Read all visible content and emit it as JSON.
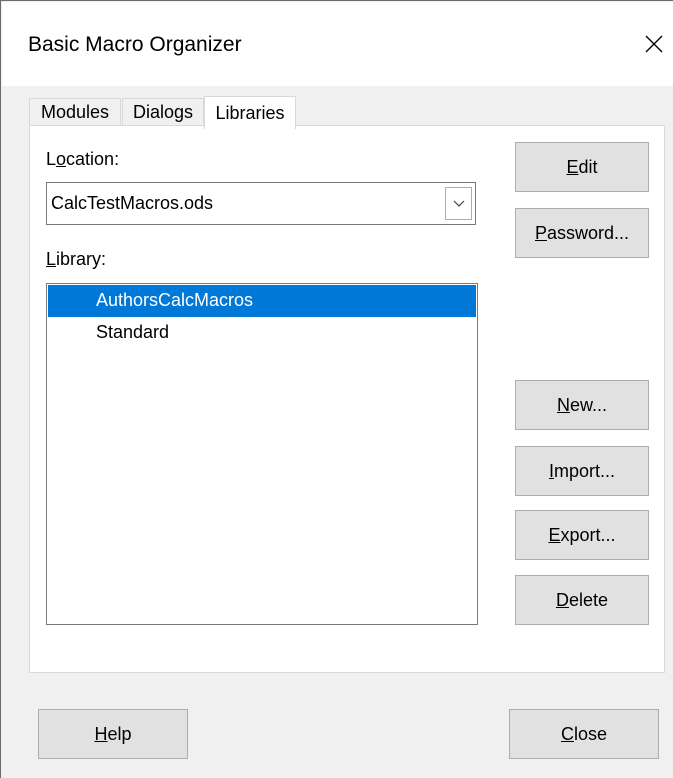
{
  "window": {
    "title": "Basic Macro Organizer",
    "close_glyph": "✕"
  },
  "tabs": [
    {
      "label": "Modules",
      "active": false
    },
    {
      "label": "Dialogs",
      "active": false
    },
    {
      "label": "Libraries",
      "active": true
    }
  ],
  "location": {
    "label_pre": "L",
    "label_mn": "o",
    "label_post": "cation:",
    "value": "CalcTestMacros.ods"
  },
  "library": {
    "label_mn": "L",
    "label_post": "ibrary:",
    "items": [
      {
        "label": "AuthorsCalcMacros",
        "selected": true
      },
      {
        "label": "Standard",
        "selected": false
      }
    ]
  },
  "buttons": {
    "edit": {
      "mn": "E",
      "rest": "dit"
    },
    "password": {
      "mn": "P",
      "rest": "assword..."
    },
    "new": {
      "mn": "N",
      "rest": "ew..."
    },
    "import": {
      "mn": "I",
      "rest": "mport..."
    },
    "export": {
      "mn": "E",
      "rest": "xport..."
    },
    "delete": {
      "mn": "D",
      "rest": "elete"
    },
    "help": {
      "mn": "H",
      "rest": "elp"
    },
    "close": {
      "mn": "C",
      "rest": "lose"
    }
  },
  "colors": {
    "selection": "#0078d7",
    "window_bg": "#f0f0f0",
    "button_bg": "#e1e1e1"
  }
}
